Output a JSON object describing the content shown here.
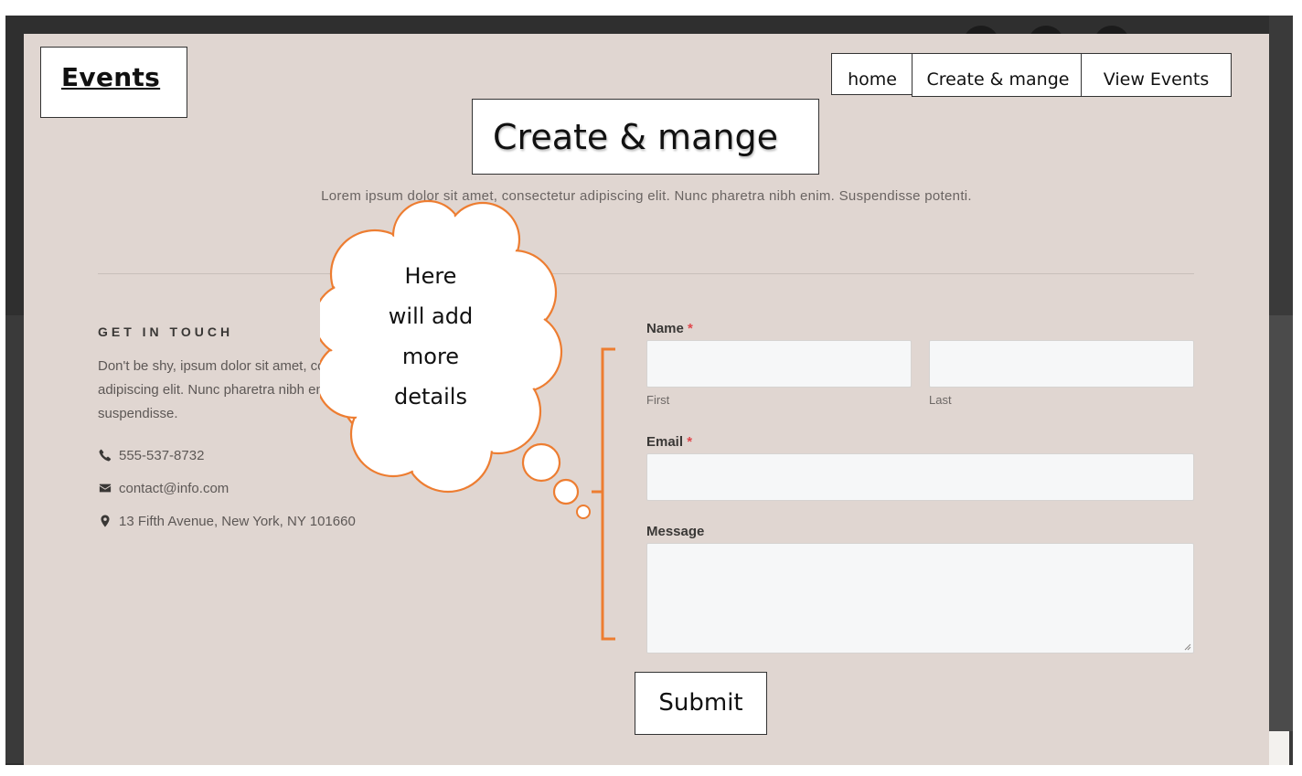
{
  "header": {
    "logo": "Events",
    "nav": [
      "home",
      "Create & mange",
      "View Events"
    ]
  },
  "page": {
    "title": "Create & mange",
    "intro": "Lorem ipsum dolor sit amet, consectetur adipiscing elit. Nunc pharetra nibh enim. Suspendisse potenti."
  },
  "contact": {
    "title": "GET IN TOUCH",
    "body_lines": [
      "Don't be shy, ipsum dolor sit amet, consectetur",
      "adipiscing elit. Nunc pharetra nibh enim.",
      "suspendisse."
    ],
    "phone": "555-537-8732",
    "email": "contact@info.com",
    "address": "13 Fifth Avenue, New York, NY 101660",
    "icons": [
      "phone-icon",
      "envelope-icon",
      "map-pin-icon"
    ]
  },
  "form": {
    "name_label": "Name",
    "required_mark": "*",
    "first_label": "First",
    "last_label": "Last",
    "first_value": "",
    "last_value": "",
    "email_label": "Email",
    "email_value": "",
    "message_label": "Message",
    "message_value": "",
    "submit_label": "Submit"
  },
  "annotation": {
    "lines": [
      "Here",
      "will add",
      "more",
      "details"
    ],
    "color": "#ed7d31"
  }
}
